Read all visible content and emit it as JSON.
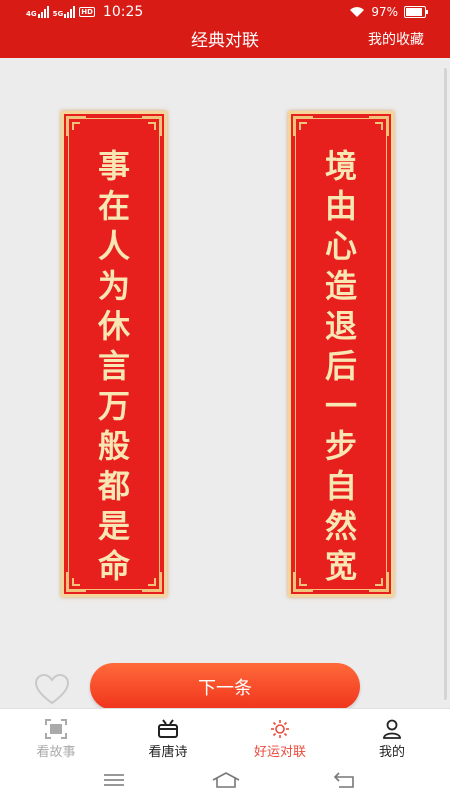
{
  "status": {
    "net1": "4G",
    "net2": "5G",
    "hd": "HD",
    "time": "10:25",
    "battery": "97%",
    "battery_level": 0.97
  },
  "header": {
    "title": "经典对联",
    "favorites": "我的收藏"
  },
  "couplet": {
    "left": [
      "事",
      "在",
      "人",
      "为",
      "休",
      "言",
      "万",
      "般",
      "都",
      "是",
      "命"
    ],
    "right": [
      "境",
      "由",
      "心",
      "造",
      "退",
      "后",
      "一",
      "步",
      "自",
      "然",
      "宽"
    ]
  },
  "actions": {
    "next_label": "下一条"
  },
  "tabs": [
    {
      "label": "看故事",
      "icon": "scan-icon"
    },
    {
      "label": "看唐诗",
      "icon": "book-icon"
    },
    {
      "label": "好运对联",
      "icon": "sun-icon"
    },
    {
      "label": "我的",
      "icon": "person-icon"
    }
  ],
  "colors": {
    "header_red": "#d81b14",
    "scroll_red": "#e8201d",
    "gold": "#f4d59a",
    "accent": "#e94b3c"
  }
}
